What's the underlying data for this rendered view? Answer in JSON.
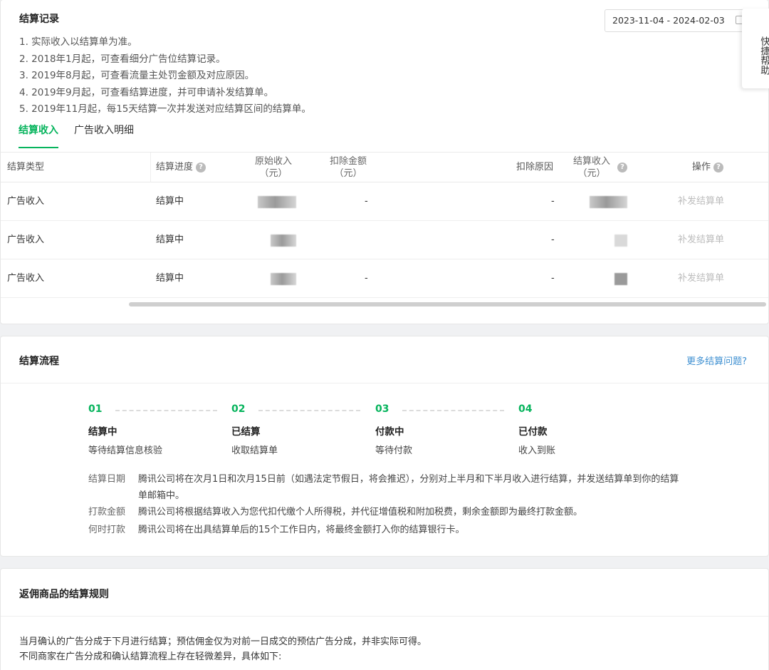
{
  "records": {
    "title": "结算记录",
    "notes": [
      "1. 实际收入以结算单为准。",
      "2. 2018年1月起，可查看细分广告位结算记录。",
      "3. 2019年8月起，可查看流量主处罚金额及对应原因。",
      "4. 2019年9月起，可查看结算进度，并可申请补发结算单。",
      "5. 2019年11月起，每15天结算一次并发送对应结算区间的结算单。"
    ],
    "date_range": "2023-11-04 - 2024-02-03",
    "tabs": [
      "结算收入",
      "广告收入明细"
    ],
    "active_tab": 0,
    "table": {
      "headers": {
        "type": "结算类型",
        "progress": "结算进度",
        "original_a": "原始收入",
        "original_b": "（元）",
        "deduct_a": "扣除金额",
        "deduct_b": "（元）",
        "reason": "扣除原因",
        "income_a": "结算收入",
        "income_b": "（元）",
        "action": "操作"
      },
      "rows": [
        {
          "type": "广告收入",
          "progress": "结算中",
          "deduct": "-",
          "reason": "-",
          "action": "补发结算单"
        },
        {
          "type": "广告收入",
          "progress": "结算中",
          "deduct": "",
          "reason": "-",
          "action": "补发结算单"
        },
        {
          "type": "广告收入",
          "progress": "结算中",
          "deduct": "-",
          "reason": "-",
          "action": "补发结算单"
        }
      ]
    }
  },
  "quick_help": "快捷帮助",
  "flow": {
    "title": "结算流程",
    "more_link": "更多结算问题?",
    "steps": [
      {
        "num": "01",
        "title": "结算中",
        "desc": "等待结算信息核验"
      },
      {
        "num": "02",
        "title": "已结算",
        "desc": "收取结算单"
      },
      {
        "num": "03",
        "title": "付款中",
        "desc": "等待付款"
      },
      {
        "num": "04",
        "title": "已付款",
        "desc": "收入到账"
      }
    ],
    "info": [
      {
        "label": "结算日期",
        "text": "腾讯公司将在次月1日和次月15日前（如遇法定节假日，将会推迟），分别对上半月和下半月收入进行结算，并发送结算单到你的结算单邮箱中。"
      },
      {
        "label": "打款金额",
        "text": "腾讯公司将根据结算收入为您代扣代缴个人所得税，并代征增值税和附加税费，剩余金额即为最终打款金额。"
      },
      {
        "label": "何时打款",
        "text": "腾讯公司将在出具结算单后的15个工作日内，将最终金额打入你的结算银行卡。"
      }
    ]
  },
  "rules": {
    "title": "返佣商品的结算规则",
    "lines": [
      "当月确认的广告分成于下月进行结算；预估佣金仅为对前一日成交的预估广告分成，并非实际可得。",
      "不同商家在广告分成和确认结算流程上存在轻微差异，具体如下:"
    ]
  },
  "colors": {
    "accent": "#07b45d",
    "link": "#3d8fd1"
  }
}
